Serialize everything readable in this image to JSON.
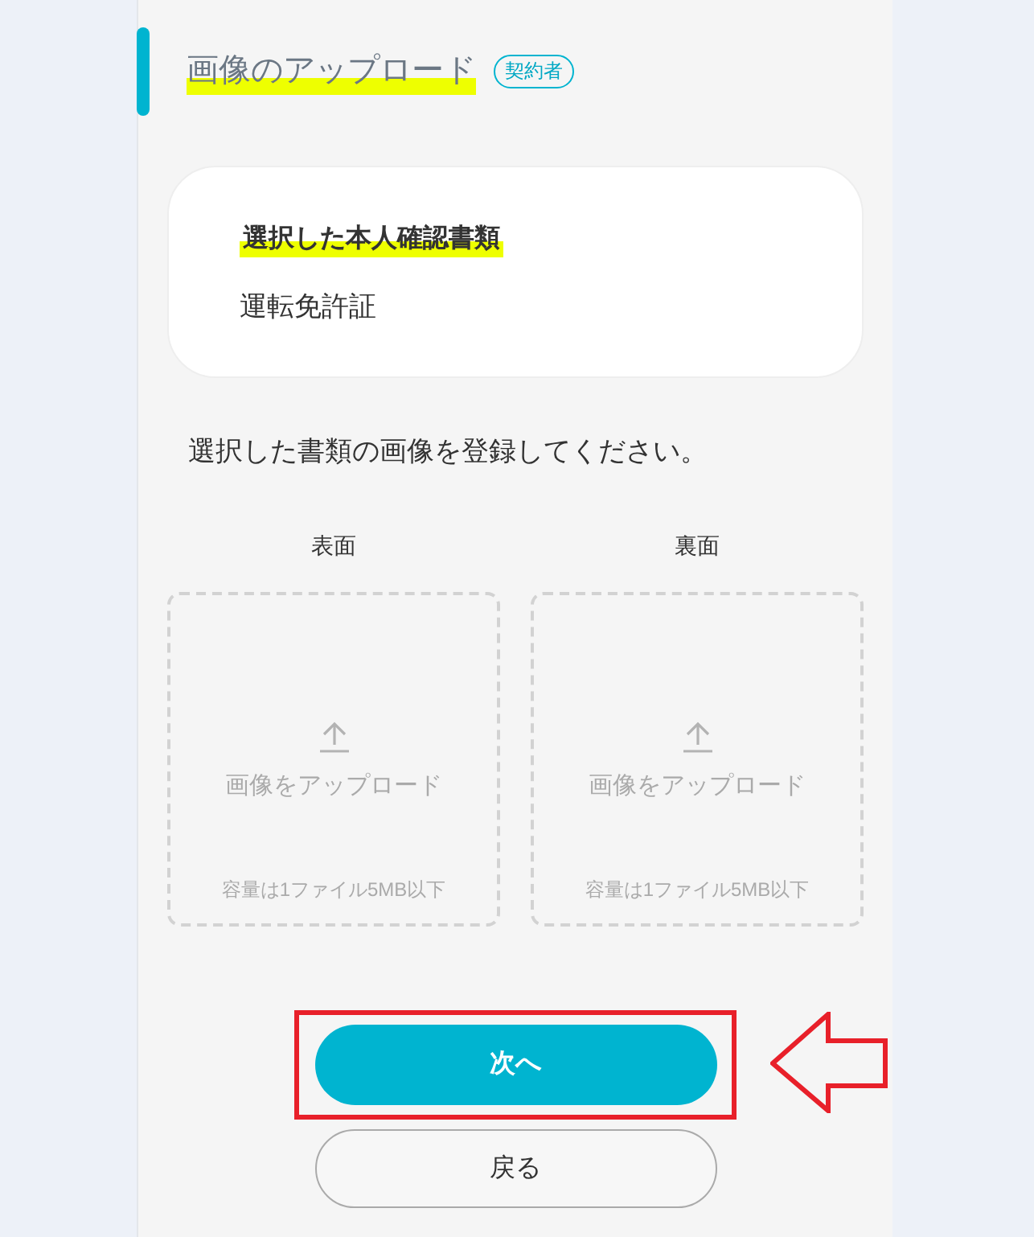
{
  "section": {
    "title": "画像のアップロード",
    "badge": "契約者"
  },
  "selected_document": {
    "label": "選択した本人確認書類",
    "value": "運転免許証"
  },
  "instruction": "選択した書類の画像を登録してください。",
  "uploads": [
    {
      "label": "表面",
      "prompt": "画像をアップロード",
      "note": "容量は1ファイル5MB以下"
    },
    {
      "label": "裏面",
      "prompt": "画像をアップロード",
      "note": "容量は1ファイル5MB以下"
    }
  ],
  "buttons": [
    {
      "label": "次へ",
      "kind": "primary",
      "annotated": true
    },
    {
      "label": "戻る",
      "kind": "secondary",
      "annotated": false
    }
  ]
}
